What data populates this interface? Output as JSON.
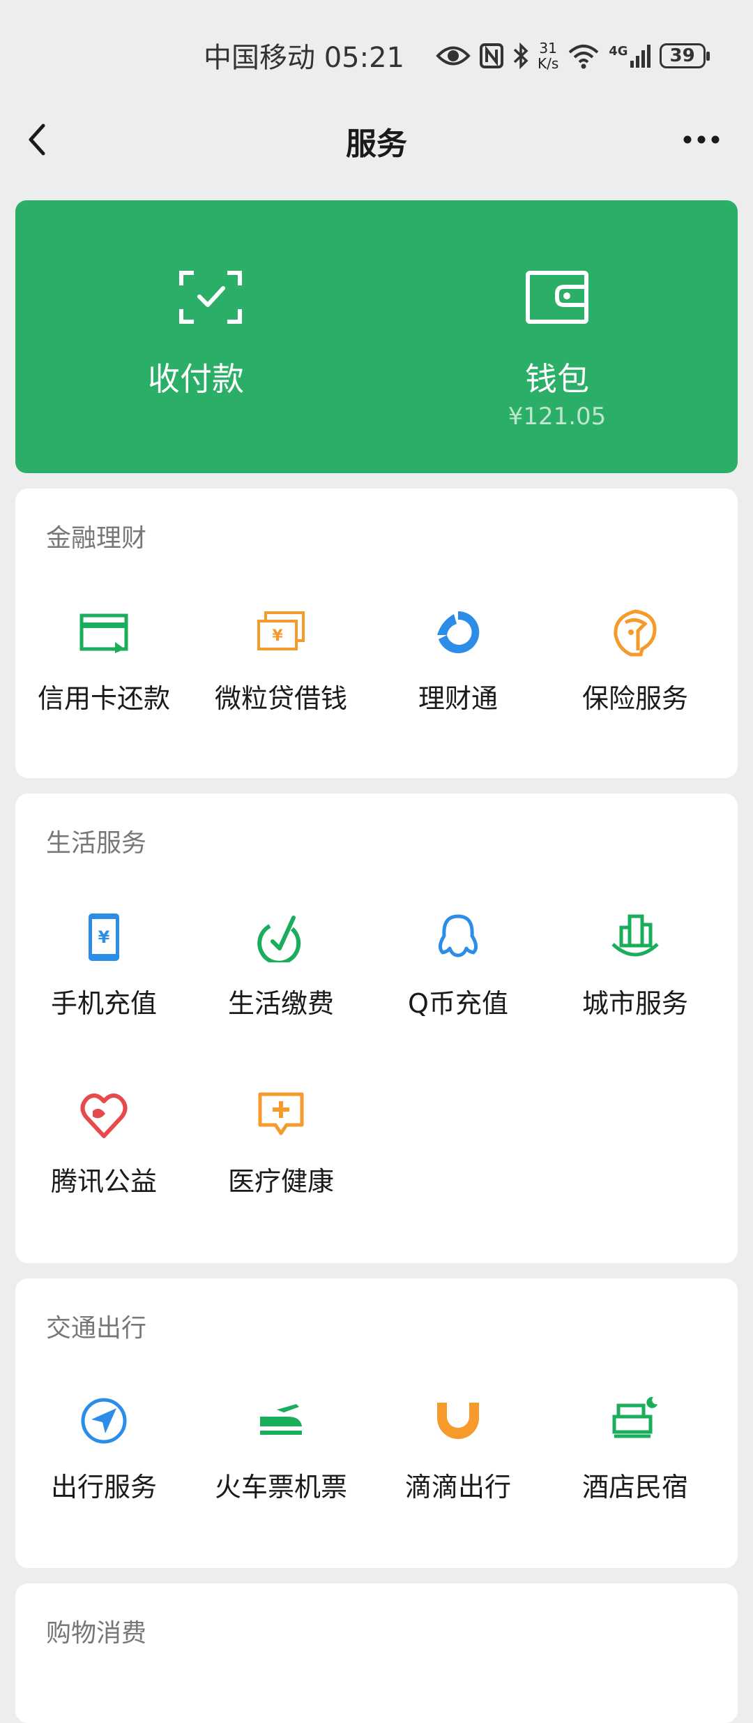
{
  "status_bar": {
    "carrier_time": "中国移动 05:21",
    "net_speed_top": "31",
    "net_speed_unit": "K/s",
    "net_type": "4G",
    "battery": "39"
  },
  "header": {
    "title": "服务"
  },
  "wallet_card": {
    "bg_color": "#2bae67",
    "pay": {
      "label": "收付款",
      "icon": "scan-check-icon"
    },
    "wallet": {
      "label": "钱包",
      "balance": "¥121.05",
      "icon": "wallet-icon"
    }
  },
  "sections": [
    {
      "title": "金融理财",
      "items": [
        {
          "label": "信用卡还款",
          "icon": "credit-card-icon",
          "color": "#1aad5b"
        },
        {
          "label": "微粒贷借钱",
          "icon": "loan-icon",
          "color": "#f59a2b"
        },
        {
          "label": "理财通",
          "icon": "wealth-icon",
          "color": "#2b8de8"
        },
        {
          "label": "保险服务",
          "icon": "insurance-icon",
          "color": "#f59a2b"
        }
      ]
    },
    {
      "title": "生活服务",
      "items": [
        {
          "label": "手机充值",
          "icon": "phone-recharge-icon",
          "color": "#2b8de8"
        },
        {
          "label": "生活缴费",
          "icon": "utility-pay-icon",
          "color": "#1aad5b"
        },
        {
          "label": "Q币充值",
          "icon": "qq-coin-icon",
          "color": "#2b8de8"
        },
        {
          "label": "城市服务",
          "icon": "city-service-icon",
          "color": "#1aad5b"
        },
        {
          "label": "腾讯公益",
          "icon": "charity-heart-icon",
          "color": "#e64a4a"
        },
        {
          "label": "医疗健康",
          "icon": "medical-icon",
          "color": "#f59a2b"
        }
      ]
    },
    {
      "title": "交通出行",
      "items": [
        {
          "label": "出行服务",
          "icon": "navigation-icon",
          "color": "#2b8de8"
        },
        {
          "label": "火车票机票",
          "icon": "train-plane-icon",
          "color": "#1aad5b"
        },
        {
          "label": "滴滴出行",
          "icon": "didi-icon",
          "color": "#f59a2b"
        },
        {
          "label": "酒店民宿",
          "icon": "hotel-bed-icon",
          "color": "#1aad5b"
        }
      ]
    },
    {
      "title": "购物消费",
      "items": []
    }
  ]
}
